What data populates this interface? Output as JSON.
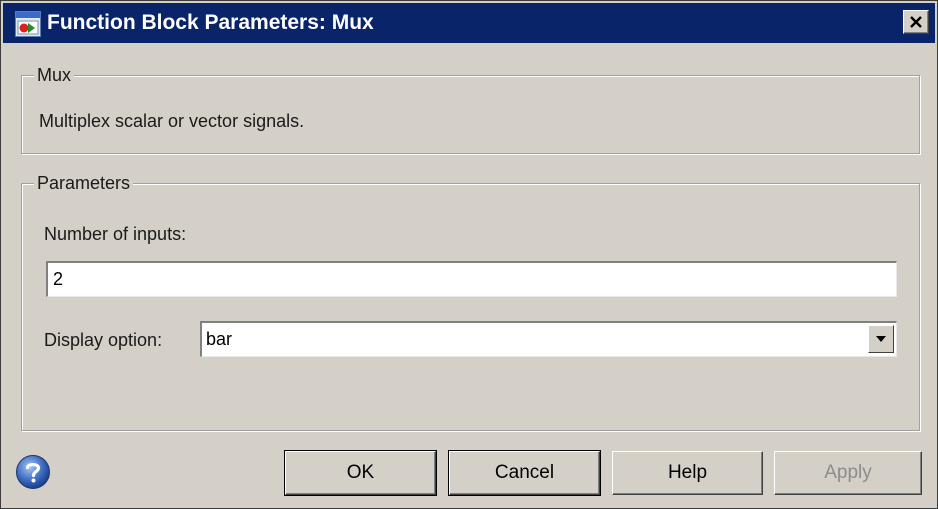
{
  "window": {
    "title": "Function Block Parameters: Mux",
    "close_label": "close"
  },
  "mux_group": {
    "legend": "Mux",
    "description": "Multiplex scalar or vector signals."
  },
  "params_group": {
    "legend": "Parameters",
    "inputs_label": "Number of inputs:",
    "inputs_value": "2",
    "display_label": "Display option:",
    "display_value": "bar"
  },
  "buttons": {
    "ok": "OK",
    "cancel": "Cancel",
    "help": "Help",
    "apply": "Apply"
  },
  "icons": {
    "app": "simulink-block-icon",
    "close": "close-icon",
    "dropdown": "chevron-down-icon",
    "help": "help-icon"
  },
  "colors": {
    "titlebar": "#0a246a",
    "dialog_bg": "#d4d0c8",
    "disabled_text": "#8c8c8c"
  }
}
